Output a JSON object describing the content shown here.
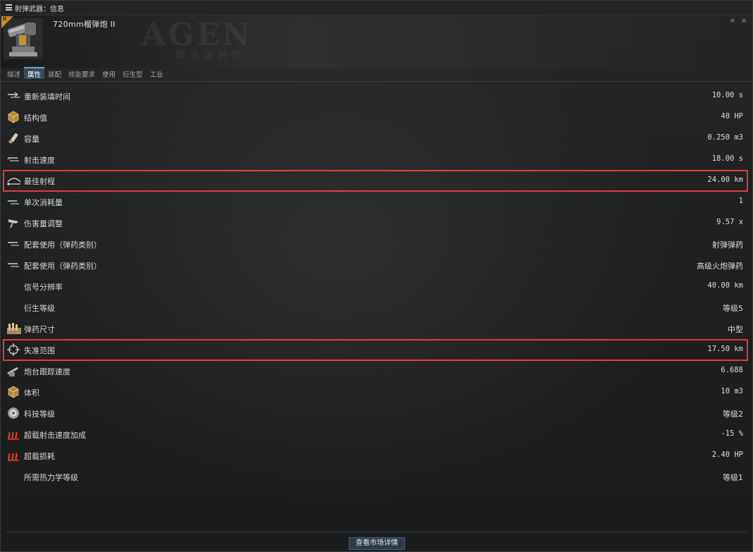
{
  "window": {
    "title": "射弹武器：信息",
    "collapse_glyph": "« »"
  },
  "item": {
    "name": "720mm榴弹炮 II",
    "meta_mark": "II"
  },
  "header_watermark": {
    "line1": "AGEN",
    "line2": "聚合体转移"
  },
  "tabs": [
    {
      "label": "描述",
      "active": false
    },
    {
      "label": "属性",
      "active": true
    },
    {
      "label": "装配",
      "active": false
    },
    {
      "label": "技能要求",
      "active": false
    },
    {
      "label": "使用",
      "active": false
    },
    {
      "label": "衍生型",
      "active": false
    },
    {
      "label": "工业",
      "active": false
    }
  ],
  "attributes": [
    {
      "icon": "reload-arrows-icon",
      "label": "重新装填时间",
      "value": "10.00 s"
    },
    {
      "icon": "structure-box-icon",
      "label": "结构值",
      "value": "40 HP"
    },
    {
      "icon": "capacity-canister-icon",
      "label": "容量",
      "value": "0.250 m3"
    },
    {
      "icon": "rate-of-fire-icon",
      "label": "射击速度",
      "value": "18.00 s"
    },
    {
      "icon": "optimal-range-icon",
      "label": "最佳射程",
      "value": "24.00 km"
    },
    {
      "icon": "charges-per-cycle-icon",
      "label": "单次消耗量",
      "value": "1"
    },
    {
      "icon": "damage-modifier-icon",
      "label": "伤害量调整",
      "value": "9.57 x"
    },
    {
      "icon": "ammo-group-icon",
      "label": "配套使用（弹药类别）",
      "value": "射弹弹药"
    },
    {
      "icon": "ammo-group-icon",
      "label": "配套使用（弹药类别）",
      "value": "高级火炮弹药"
    },
    {
      "icon": "",
      "label": "信号分辨率",
      "value": "40.00 km"
    },
    {
      "icon": "",
      "label": "衍生等级",
      "value": "等级5"
    },
    {
      "icon": "ammo-size-icon",
      "label": "弹药尺寸",
      "value": "中型"
    },
    {
      "icon": "falloff-crosshair-icon",
      "label": "失准范围",
      "value": "17.50 km"
    },
    {
      "icon": "turret-tracking-icon",
      "label": "炮台跟踪速度",
      "value": "6.688"
    },
    {
      "icon": "volume-box-icon",
      "label": "体积",
      "value": "10 m3"
    },
    {
      "icon": "tech-level-icon",
      "label": "科技等级",
      "value": "等级2"
    },
    {
      "icon": "overload-heat-icon",
      "label": "超载射击速度加成",
      "value": "-15 %"
    },
    {
      "icon": "overload-heat-icon",
      "label": "超载损耗",
      "value": "2.40 HP"
    },
    {
      "icon": "",
      "label": "所需热力学等级",
      "value": "等级1"
    }
  ],
  "highlighted_rows": [
    4,
    12
  ],
  "colors": {
    "highlight_border": "#e03a3a",
    "active_tab": "#3a4a5a",
    "meta_badge": "#c98b28"
  },
  "footer": {
    "market_button_label": "查看市场详情"
  }
}
